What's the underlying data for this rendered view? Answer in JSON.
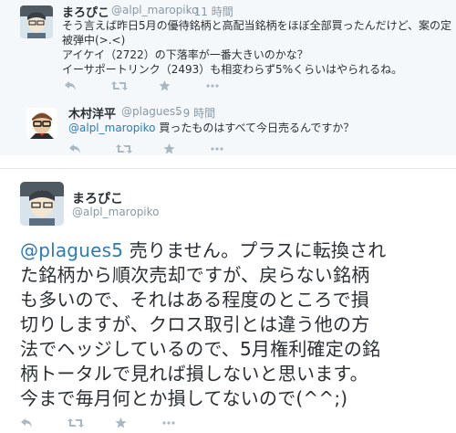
{
  "tweet1": {
    "name": "まろぴこ",
    "handle": "@alpl_maropiko",
    "time": "· 11 時間",
    "lines": [
      "そう言えば昨日5月の優待銘柄と高配当銘柄をほぼ全部買ったんだけど、案の定",
      "被弾中(>.<)",
      "アイケイ（2722）の下落率が一番大きいのかな？",
      "イーサポートリンク（2493）も相変わらず5%くらいはやられるね。"
    ]
  },
  "tweet2": {
    "name": "木村洋平",
    "handle": "@plagues5",
    "time": "· 9 時間",
    "mention": "@alpl_maropiko",
    "text": " 買ったものはすべて今日売るんですか？"
  },
  "main": {
    "name": "まろぴこ",
    "handle": "@alpl_maropiko",
    "mention": "@plagues5",
    "first_line_rest": " 売りません。プラスに転換され",
    "lines": [
      "た銘柄から順次売却ですが、戻らない銘柄",
      "も多いので、それはある程度のところで損",
      "切りしますが、クロス取引とは違う他の方",
      "法でヘッジしているので、5月権利確定の銘",
      "柄トータルで見れば損しないと思います。",
      "今まで毎月何とか損してないので(^^;)"
    ]
  },
  "icons": [
    "reply-icon",
    "retweet-icon",
    "favorite-icon",
    "more-icon"
  ],
  "colors": {
    "accent": "#2b7bb9",
    "muted": "#8899a6",
    "text": "#292f33",
    "bg_alt": "#f5f8fa"
  }
}
